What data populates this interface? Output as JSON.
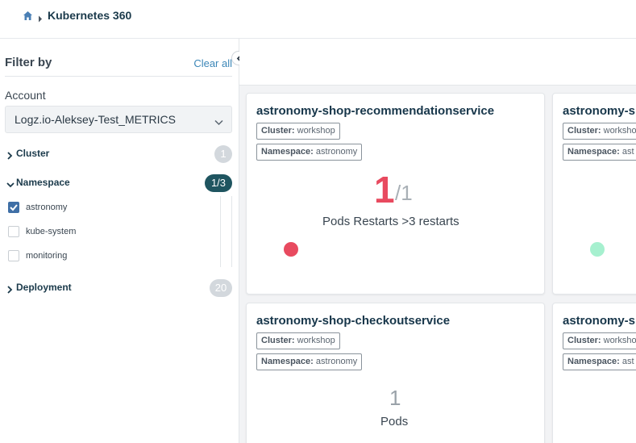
{
  "breadcrumb": {
    "title": "Kubernetes 360"
  },
  "sidebar": {
    "filter_title": "Filter by",
    "clear_all": "Clear all",
    "account_label": "Account",
    "account_value": "Logz.io-Aleksey-Test_METRICS",
    "facets": {
      "cluster": {
        "label": "Cluster",
        "count": "1"
      },
      "namespace": {
        "label": "Namespace",
        "count": "1/3"
      },
      "deployment": {
        "label": "Deployment",
        "count": "20"
      }
    },
    "namespaces": [
      {
        "label": "astronomy",
        "checked": true
      },
      {
        "label": "kube-system",
        "checked": false
      },
      {
        "label": "monitoring",
        "checked": false
      }
    ]
  },
  "cards": [
    {
      "title": "astronomy-shop-recommendationservice",
      "cluster_key": "Cluster:",
      "cluster_value": "workshop",
      "namespace_key": "Namespace:",
      "namespace_value": "astronomy",
      "value": "1",
      "total": "/1",
      "metric": "Pods Restarts >3 restarts",
      "status_color": "#e84a5f"
    },
    {
      "title": "astronomy-sh",
      "cluster_key": "Cluster:",
      "cluster_value": "worksho",
      "namespace_key": "Namespace:",
      "namespace_value": "ast",
      "status_color": "#a6f0cf"
    },
    {
      "title": "astronomy-shop-checkoutservice",
      "cluster_key": "Cluster:",
      "cluster_value": "workshop",
      "namespace_key": "Namespace:",
      "namespace_value": "astronomy",
      "value": "1",
      "metric": "Pods"
    },
    {
      "title": "astronomy-sh",
      "cluster_key": "Cluster:",
      "cluster_value": "worksho",
      "namespace_key": "Namespace:",
      "namespace_value": "ast"
    }
  ],
  "icons": {
    "home": "home-icon",
    "breadcrumb_separator": "chevron-right-icon",
    "collapse": "chevron-left-icon",
    "dropdown": "chevron-down-icon"
  },
  "colors": {
    "accent": "#3c87b8",
    "badge_active": "#1f5560",
    "error": "#e84a5f",
    "ok": "#a6f0cf"
  }
}
